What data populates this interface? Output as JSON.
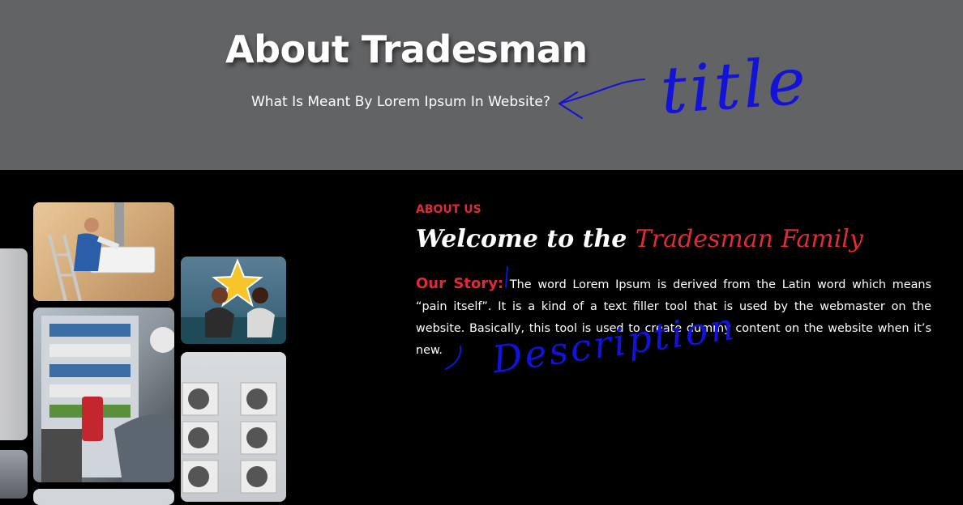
{
  "hero": {
    "title": "About Tradesman",
    "subtitle": "What Is Meant By Lorem Ipsum In Website?"
  },
  "annotations": {
    "title_note": "title",
    "description_note": "Description"
  },
  "about": {
    "eyebrow": "ABOUT US",
    "heading_lead": "Welcome to the ",
    "heading_accent": "Tradesman Family",
    "story_label": "Our Story:",
    "story_text": "The word Lorem Ipsum is derived from the Latin word which means “pain itself”. It is a kind of a text filler tool that is used by the webmaster on the website. Basically, this tool is used to create dummy content on the website when it’s new."
  },
  "colors": {
    "hero_background": "#626365",
    "page_background": "#000000",
    "accent": "#e02b34",
    "annotation_ink": "#1212d8"
  }
}
